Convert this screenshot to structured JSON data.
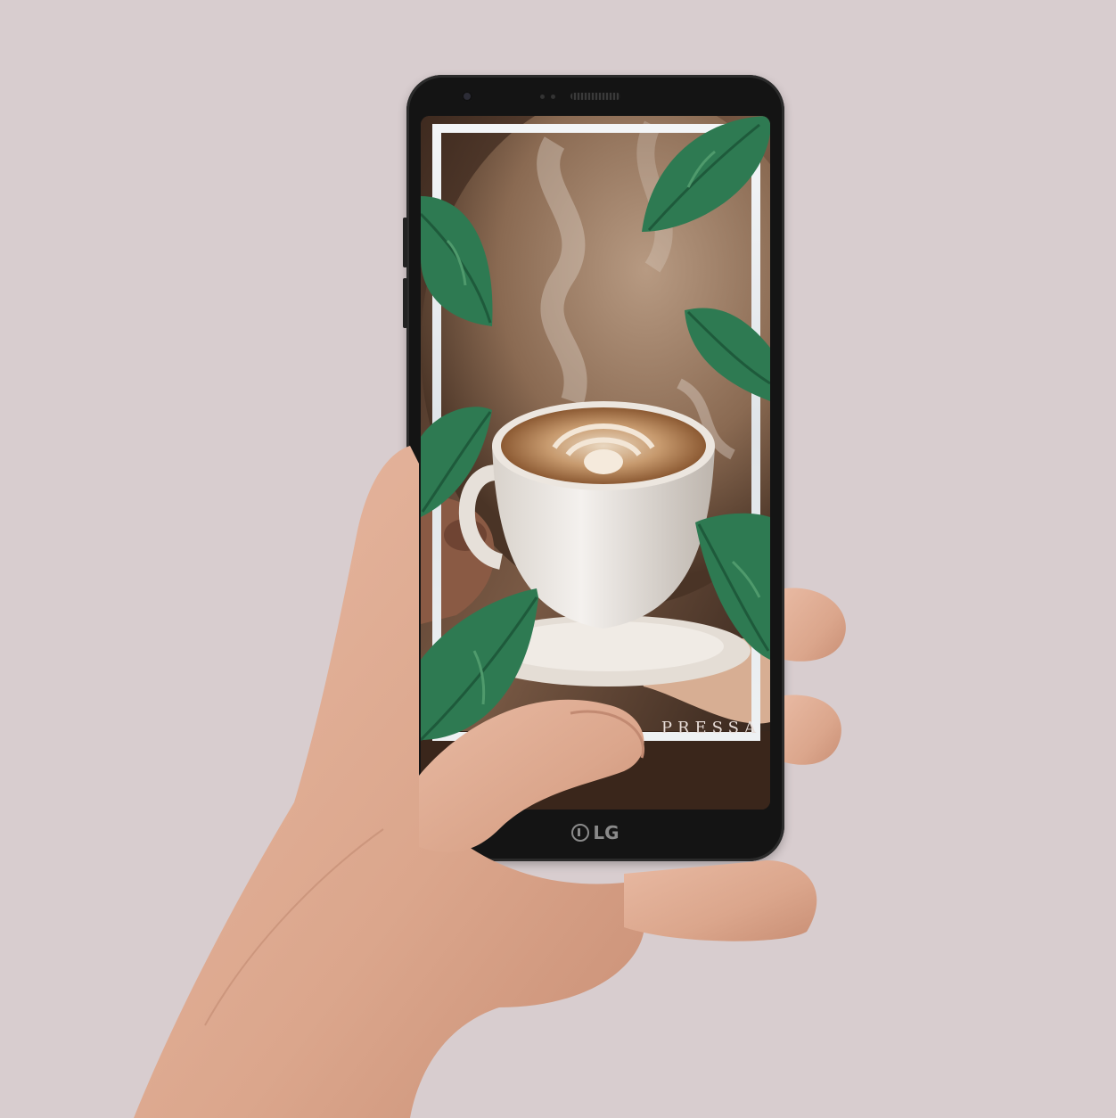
{
  "scene": {
    "background_color": "#d8cdcf",
    "phone_color": "#141414",
    "leaf_color": "#2e7a52"
  },
  "phone": {
    "brand_label": "LG"
  },
  "screen": {
    "brand_text": "PRESSA"
  }
}
